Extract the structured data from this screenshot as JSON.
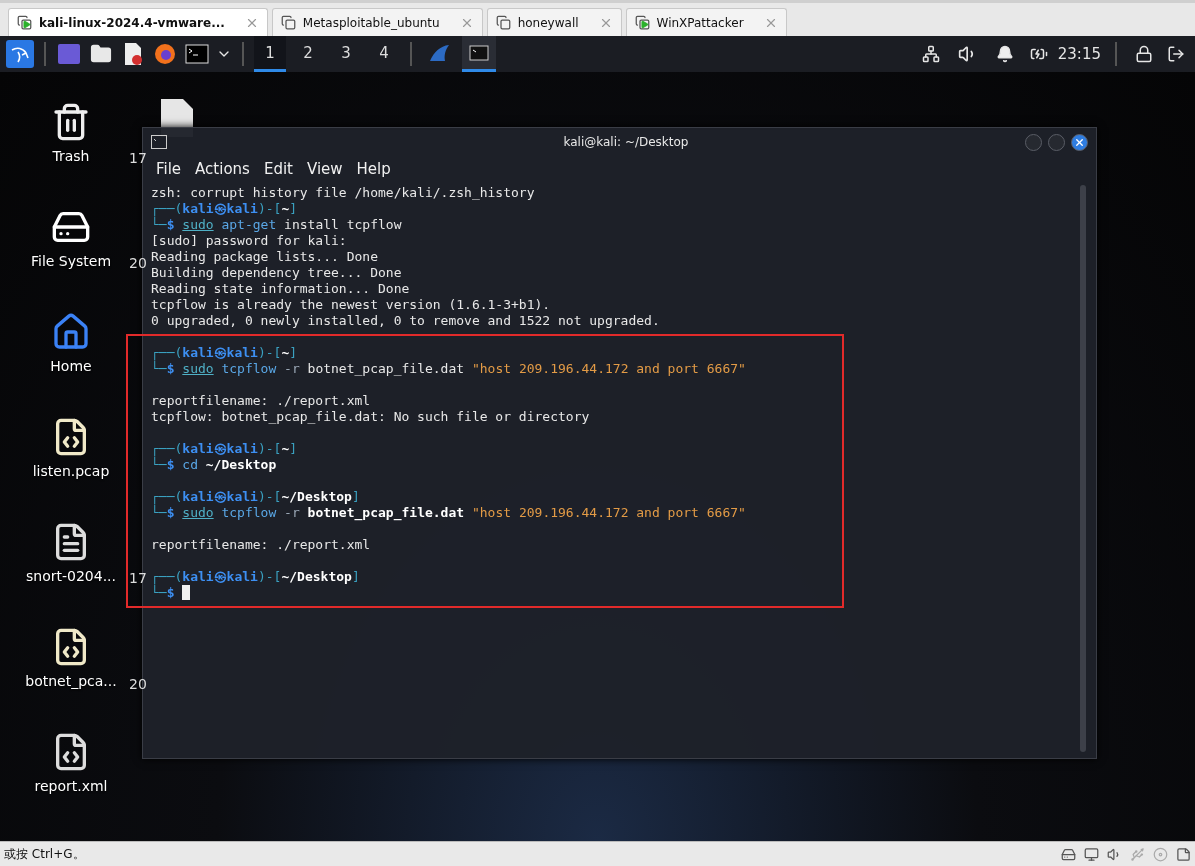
{
  "vm_tabs": [
    {
      "label": "kali-linux-2024.4-vmware...",
      "selected": true,
      "running": true
    },
    {
      "label": "Metasploitable_ubuntu",
      "selected": false,
      "running": false
    },
    {
      "label": "honeywall",
      "selected": false,
      "running": false
    },
    {
      "label": "WinXPattacker",
      "selected": false,
      "running": true
    }
  ],
  "panel": {
    "workspaces": [
      {
        "label": "1",
        "selected": true
      },
      {
        "label": "2",
        "selected": false
      },
      {
        "label": "3",
        "selected": false
      },
      {
        "label": "4",
        "selected": false
      }
    ],
    "clock": "23:15"
  },
  "desktop": {
    "icons": [
      {
        "label": "Trash",
        "kind": "trash"
      },
      {
        "label": "File System",
        "kind": "drive"
      },
      {
        "label": "Home",
        "kind": "home"
      },
      {
        "label": "listen.pcap",
        "kind": "binary"
      },
      {
        "label": "snort-0204...",
        "kind": "text"
      },
      {
        "label": "botnet_pca...",
        "kind": "binary"
      },
      {
        "label": "report.xml",
        "kind": "xml"
      }
    ],
    "hidden_labels": [
      "17",
      "20",
      "17",
      "20"
    ]
  },
  "terminal": {
    "title": "kali@kali: ~/Desktop",
    "menu": [
      "File",
      "Actions",
      "Edit",
      "View",
      "Help"
    ],
    "lines": [
      {
        "kind": "text",
        "segments": [
          {
            "kind": "out",
            "t": "zsh: corrupt history file /home/kali/.zsh_history"
          }
        ]
      },
      {
        "kind": "text",
        "segments": [
          {
            "kind": "frame",
            "t": "┌──("
          },
          {
            "kind": "user",
            "t": "kali㉿kali"
          },
          {
            "kind": "frame",
            "t": ")-["
          },
          {
            "kind": "path",
            "t": "~"
          },
          {
            "kind": "frame",
            "t": "]"
          }
        ]
      },
      {
        "kind": "text",
        "segments": [
          {
            "kind": "frame",
            "t": "└─"
          },
          {
            "kind": "dollar",
            "t": "$ "
          },
          {
            "kind": "sudo",
            "t": "sudo"
          },
          {
            "kind": "cmd",
            "t": " apt-get"
          },
          {
            "kind": "out",
            "t": " install tcpflow"
          }
        ]
      },
      {
        "kind": "text",
        "segments": [
          {
            "kind": "out",
            "t": "[sudo] password for kali:"
          }
        ]
      },
      {
        "kind": "text",
        "segments": [
          {
            "kind": "out",
            "t": "Reading package lists... Done"
          }
        ]
      },
      {
        "kind": "text",
        "segments": [
          {
            "kind": "out",
            "t": "Building dependency tree... Done"
          }
        ]
      },
      {
        "kind": "text",
        "segments": [
          {
            "kind": "out",
            "t": "Reading state information... Done"
          }
        ]
      },
      {
        "kind": "text",
        "segments": [
          {
            "kind": "out",
            "t": "tcpflow is already the newest version (1.6.1-3+b1)."
          }
        ]
      },
      {
        "kind": "text",
        "segments": [
          {
            "kind": "out",
            "t": "0 upgraded, 0 newly installed, 0 to remove and 1522 not upgraded."
          }
        ]
      },
      {
        "kind": "blank"
      },
      {
        "kind": "text",
        "segments": [
          {
            "kind": "frame",
            "t": "┌──("
          },
          {
            "kind": "user",
            "t": "kali㉿kali"
          },
          {
            "kind": "frame",
            "t": ")-["
          },
          {
            "kind": "path",
            "t": "~"
          },
          {
            "kind": "frame",
            "t": "]"
          }
        ]
      },
      {
        "kind": "text",
        "segments": [
          {
            "kind": "frame",
            "t": "└─"
          },
          {
            "kind": "dollar",
            "t": "$ "
          },
          {
            "kind": "sudo",
            "t": "sudo"
          },
          {
            "kind": "cmd",
            "t": " tcpflow"
          },
          {
            "kind": "arg",
            "t": " -r"
          },
          {
            "kind": "out",
            "t": " botnet_pcap_file.dat "
          },
          {
            "kind": "string",
            "t": "\"host 209.196.44.172 and port 6667\""
          }
        ]
      },
      {
        "kind": "blank"
      },
      {
        "kind": "text",
        "segments": [
          {
            "kind": "out",
            "t": "reportfilename: ./report.xml"
          }
        ]
      },
      {
        "kind": "text",
        "segments": [
          {
            "kind": "out",
            "t": "tcpflow: botnet_pcap_file.dat: No such file or directory"
          }
        ]
      },
      {
        "kind": "blank"
      },
      {
        "kind": "text",
        "segments": [
          {
            "kind": "frame",
            "t": "┌──("
          },
          {
            "kind": "user",
            "t": "kali㉿kali"
          },
          {
            "kind": "frame",
            "t": ")-["
          },
          {
            "kind": "path",
            "t": "~"
          },
          {
            "kind": "frame",
            "t": "]"
          }
        ]
      },
      {
        "kind": "text",
        "segments": [
          {
            "kind": "frame",
            "t": "└─"
          },
          {
            "kind": "dollar",
            "t": "$ "
          },
          {
            "kind": "cmd",
            "t": "cd"
          },
          {
            "kind": "bold",
            "t": " ~/Desktop"
          }
        ]
      },
      {
        "kind": "blank"
      },
      {
        "kind": "text",
        "segments": [
          {
            "kind": "frame",
            "t": "┌──("
          },
          {
            "kind": "user",
            "t": "kali㉿kali"
          },
          {
            "kind": "frame",
            "t": ")-["
          },
          {
            "kind": "path",
            "t": "~/Desktop"
          },
          {
            "kind": "frame",
            "t": "]"
          }
        ]
      },
      {
        "kind": "text",
        "segments": [
          {
            "kind": "frame",
            "t": "└─"
          },
          {
            "kind": "dollar",
            "t": "$ "
          },
          {
            "kind": "sudo",
            "t": "sudo"
          },
          {
            "kind": "cmd",
            "t": " tcpflow"
          },
          {
            "kind": "arg",
            "t": " -r"
          },
          {
            "kind": "bold",
            "t": " botnet_pcap_file.dat"
          },
          {
            "kind": "string",
            "t": " \"host 209.196.44.172 and port 6667\""
          }
        ]
      },
      {
        "kind": "blank"
      },
      {
        "kind": "text",
        "segments": [
          {
            "kind": "out",
            "t": "reportfilename: ./report.xml"
          }
        ]
      },
      {
        "kind": "blank"
      },
      {
        "kind": "text",
        "segments": [
          {
            "kind": "frame",
            "t": "┌──("
          },
          {
            "kind": "user",
            "t": "kali㉿kali"
          },
          {
            "kind": "frame",
            "t": ")-["
          },
          {
            "kind": "path",
            "t": "~/Desktop"
          },
          {
            "kind": "frame",
            "t": "]"
          }
        ]
      },
      {
        "kind": "text",
        "cursor": true,
        "segments": [
          {
            "kind": "frame",
            "t": "└─"
          },
          {
            "kind": "dollar",
            "t": "$"
          }
        ]
      }
    ]
  },
  "status_bar": {
    "hint": "或按 Ctrl+G。"
  }
}
